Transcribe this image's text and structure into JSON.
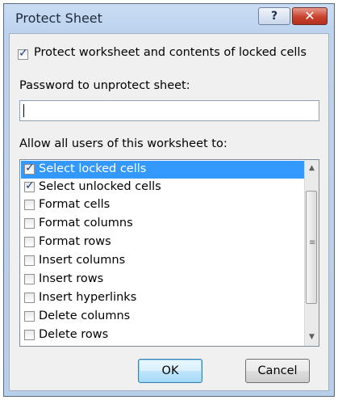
{
  "window": {
    "title": "Protect Sheet",
    "help_label": "?",
    "close_label": "✕"
  },
  "protect_checkbox": {
    "label": "Protect worksheet and contents of locked cells",
    "checked": true
  },
  "password": {
    "label": "Password to unprotect sheet:",
    "value": ""
  },
  "allow": {
    "label": "Allow all users of this worksheet to:",
    "items": [
      {
        "label": "Select locked cells",
        "checked": true,
        "selected": true
      },
      {
        "label": "Select unlocked cells",
        "checked": true,
        "selected": false
      },
      {
        "label": "Format cells",
        "checked": false,
        "selected": false
      },
      {
        "label": "Format columns",
        "checked": false,
        "selected": false
      },
      {
        "label": "Format rows",
        "checked": false,
        "selected": false
      },
      {
        "label": "Insert columns",
        "checked": false,
        "selected": false
      },
      {
        "label": "Insert rows",
        "checked": false,
        "selected": false
      },
      {
        "label": "Insert hyperlinks",
        "checked": false,
        "selected": false
      },
      {
        "label": "Delete columns",
        "checked": false,
        "selected": false
      },
      {
        "label": "Delete rows",
        "checked": false,
        "selected": false
      }
    ]
  },
  "buttons": {
    "ok_label": "OK",
    "cancel_label": "Cancel"
  }
}
